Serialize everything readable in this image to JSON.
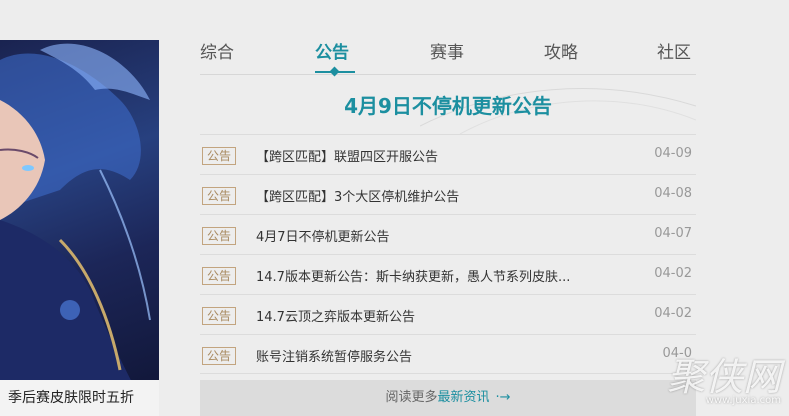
{
  "banner": {
    "caption": "季后赛皮肤限时五折"
  },
  "tabs": [
    {
      "label": "综合"
    },
    {
      "label": "公告"
    },
    {
      "label": "赛事"
    },
    {
      "label": "攻略"
    },
    {
      "label": "社区"
    }
  ],
  "headline": "4月9日不停机更新公告",
  "news": [
    {
      "tag": "公告",
      "title": "【跨区匹配】联盟四区开服公告",
      "date": "04-09"
    },
    {
      "tag": "公告",
      "title": "【跨区匹配】3个大区停机维护公告",
      "date": "04-08"
    },
    {
      "tag": "公告",
      "title": "4月7日不停机更新公告",
      "date": "04-07"
    },
    {
      "tag": "公告",
      "title": "14.7版本更新公告：斯卡纳获更新，愚人节系列皮肤...",
      "date": "04-02"
    },
    {
      "tag": "公告",
      "title": "14.7云顶之弈版本更新公告",
      "date": "04-02"
    },
    {
      "tag": "公告",
      "title": "账号注销系统暂停服务公告",
      "date": "04-0"
    }
  ],
  "more": {
    "prefix": "阅读更多",
    "accent": "最新资讯",
    "arrow": "·→"
  },
  "watermark": {
    "main": "聚侠网",
    "sub": "www.juxia.com"
  },
  "colors": {
    "accent": "#1c8fa0",
    "badge": "#a98a5f"
  }
}
